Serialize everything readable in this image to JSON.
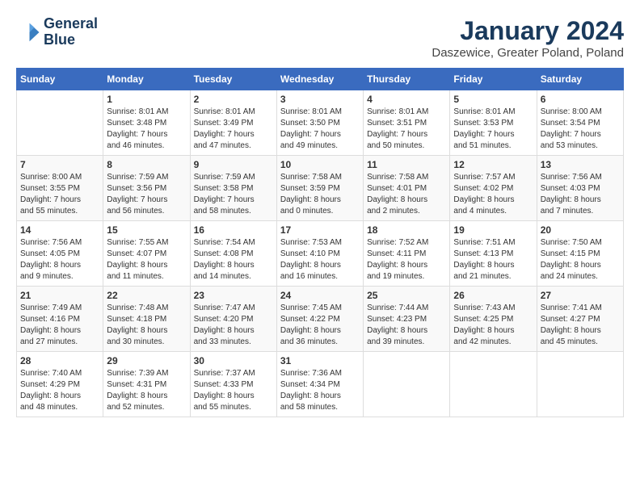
{
  "header": {
    "logo_line1": "General",
    "logo_line2": "Blue",
    "month": "January 2024",
    "location": "Daszewice, Greater Poland, Poland"
  },
  "days_of_week": [
    "Sunday",
    "Monday",
    "Tuesday",
    "Wednesday",
    "Thursday",
    "Friday",
    "Saturday"
  ],
  "weeks": [
    [
      {
        "day": "",
        "info": ""
      },
      {
        "day": "1",
        "info": "Sunrise: 8:01 AM\nSunset: 3:48 PM\nDaylight: 7 hours\nand 46 minutes."
      },
      {
        "day": "2",
        "info": "Sunrise: 8:01 AM\nSunset: 3:49 PM\nDaylight: 7 hours\nand 47 minutes."
      },
      {
        "day": "3",
        "info": "Sunrise: 8:01 AM\nSunset: 3:50 PM\nDaylight: 7 hours\nand 49 minutes."
      },
      {
        "day": "4",
        "info": "Sunrise: 8:01 AM\nSunset: 3:51 PM\nDaylight: 7 hours\nand 50 minutes."
      },
      {
        "day": "5",
        "info": "Sunrise: 8:01 AM\nSunset: 3:53 PM\nDaylight: 7 hours\nand 51 minutes."
      },
      {
        "day": "6",
        "info": "Sunrise: 8:00 AM\nSunset: 3:54 PM\nDaylight: 7 hours\nand 53 minutes."
      }
    ],
    [
      {
        "day": "7",
        "info": "Sunrise: 8:00 AM\nSunset: 3:55 PM\nDaylight: 7 hours\nand 55 minutes."
      },
      {
        "day": "8",
        "info": "Sunrise: 7:59 AM\nSunset: 3:56 PM\nDaylight: 7 hours\nand 56 minutes."
      },
      {
        "day": "9",
        "info": "Sunrise: 7:59 AM\nSunset: 3:58 PM\nDaylight: 7 hours\nand 58 minutes."
      },
      {
        "day": "10",
        "info": "Sunrise: 7:58 AM\nSunset: 3:59 PM\nDaylight: 8 hours\nand 0 minutes."
      },
      {
        "day": "11",
        "info": "Sunrise: 7:58 AM\nSunset: 4:01 PM\nDaylight: 8 hours\nand 2 minutes."
      },
      {
        "day": "12",
        "info": "Sunrise: 7:57 AM\nSunset: 4:02 PM\nDaylight: 8 hours\nand 4 minutes."
      },
      {
        "day": "13",
        "info": "Sunrise: 7:56 AM\nSunset: 4:03 PM\nDaylight: 8 hours\nand 7 minutes."
      }
    ],
    [
      {
        "day": "14",
        "info": "Sunrise: 7:56 AM\nSunset: 4:05 PM\nDaylight: 8 hours\nand 9 minutes."
      },
      {
        "day": "15",
        "info": "Sunrise: 7:55 AM\nSunset: 4:07 PM\nDaylight: 8 hours\nand 11 minutes."
      },
      {
        "day": "16",
        "info": "Sunrise: 7:54 AM\nSunset: 4:08 PM\nDaylight: 8 hours\nand 14 minutes."
      },
      {
        "day": "17",
        "info": "Sunrise: 7:53 AM\nSunset: 4:10 PM\nDaylight: 8 hours\nand 16 minutes."
      },
      {
        "day": "18",
        "info": "Sunrise: 7:52 AM\nSunset: 4:11 PM\nDaylight: 8 hours\nand 19 minutes."
      },
      {
        "day": "19",
        "info": "Sunrise: 7:51 AM\nSunset: 4:13 PM\nDaylight: 8 hours\nand 21 minutes."
      },
      {
        "day": "20",
        "info": "Sunrise: 7:50 AM\nSunset: 4:15 PM\nDaylight: 8 hours\nand 24 minutes."
      }
    ],
    [
      {
        "day": "21",
        "info": "Sunrise: 7:49 AM\nSunset: 4:16 PM\nDaylight: 8 hours\nand 27 minutes."
      },
      {
        "day": "22",
        "info": "Sunrise: 7:48 AM\nSunset: 4:18 PM\nDaylight: 8 hours\nand 30 minutes."
      },
      {
        "day": "23",
        "info": "Sunrise: 7:47 AM\nSunset: 4:20 PM\nDaylight: 8 hours\nand 33 minutes."
      },
      {
        "day": "24",
        "info": "Sunrise: 7:45 AM\nSunset: 4:22 PM\nDaylight: 8 hours\nand 36 minutes."
      },
      {
        "day": "25",
        "info": "Sunrise: 7:44 AM\nSunset: 4:23 PM\nDaylight: 8 hours\nand 39 minutes."
      },
      {
        "day": "26",
        "info": "Sunrise: 7:43 AM\nSunset: 4:25 PM\nDaylight: 8 hours\nand 42 minutes."
      },
      {
        "day": "27",
        "info": "Sunrise: 7:41 AM\nSunset: 4:27 PM\nDaylight: 8 hours\nand 45 minutes."
      }
    ],
    [
      {
        "day": "28",
        "info": "Sunrise: 7:40 AM\nSunset: 4:29 PM\nDaylight: 8 hours\nand 48 minutes."
      },
      {
        "day": "29",
        "info": "Sunrise: 7:39 AM\nSunset: 4:31 PM\nDaylight: 8 hours\nand 52 minutes."
      },
      {
        "day": "30",
        "info": "Sunrise: 7:37 AM\nSunset: 4:33 PM\nDaylight: 8 hours\nand 55 minutes."
      },
      {
        "day": "31",
        "info": "Sunrise: 7:36 AM\nSunset: 4:34 PM\nDaylight: 8 hours\nand 58 minutes."
      },
      {
        "day": "",
        "info": ""
      },
      {
        "day": "",
        "info": ""
      },
      {
        "day": "",
        "info": ""
      }
    ]
  ]
}
